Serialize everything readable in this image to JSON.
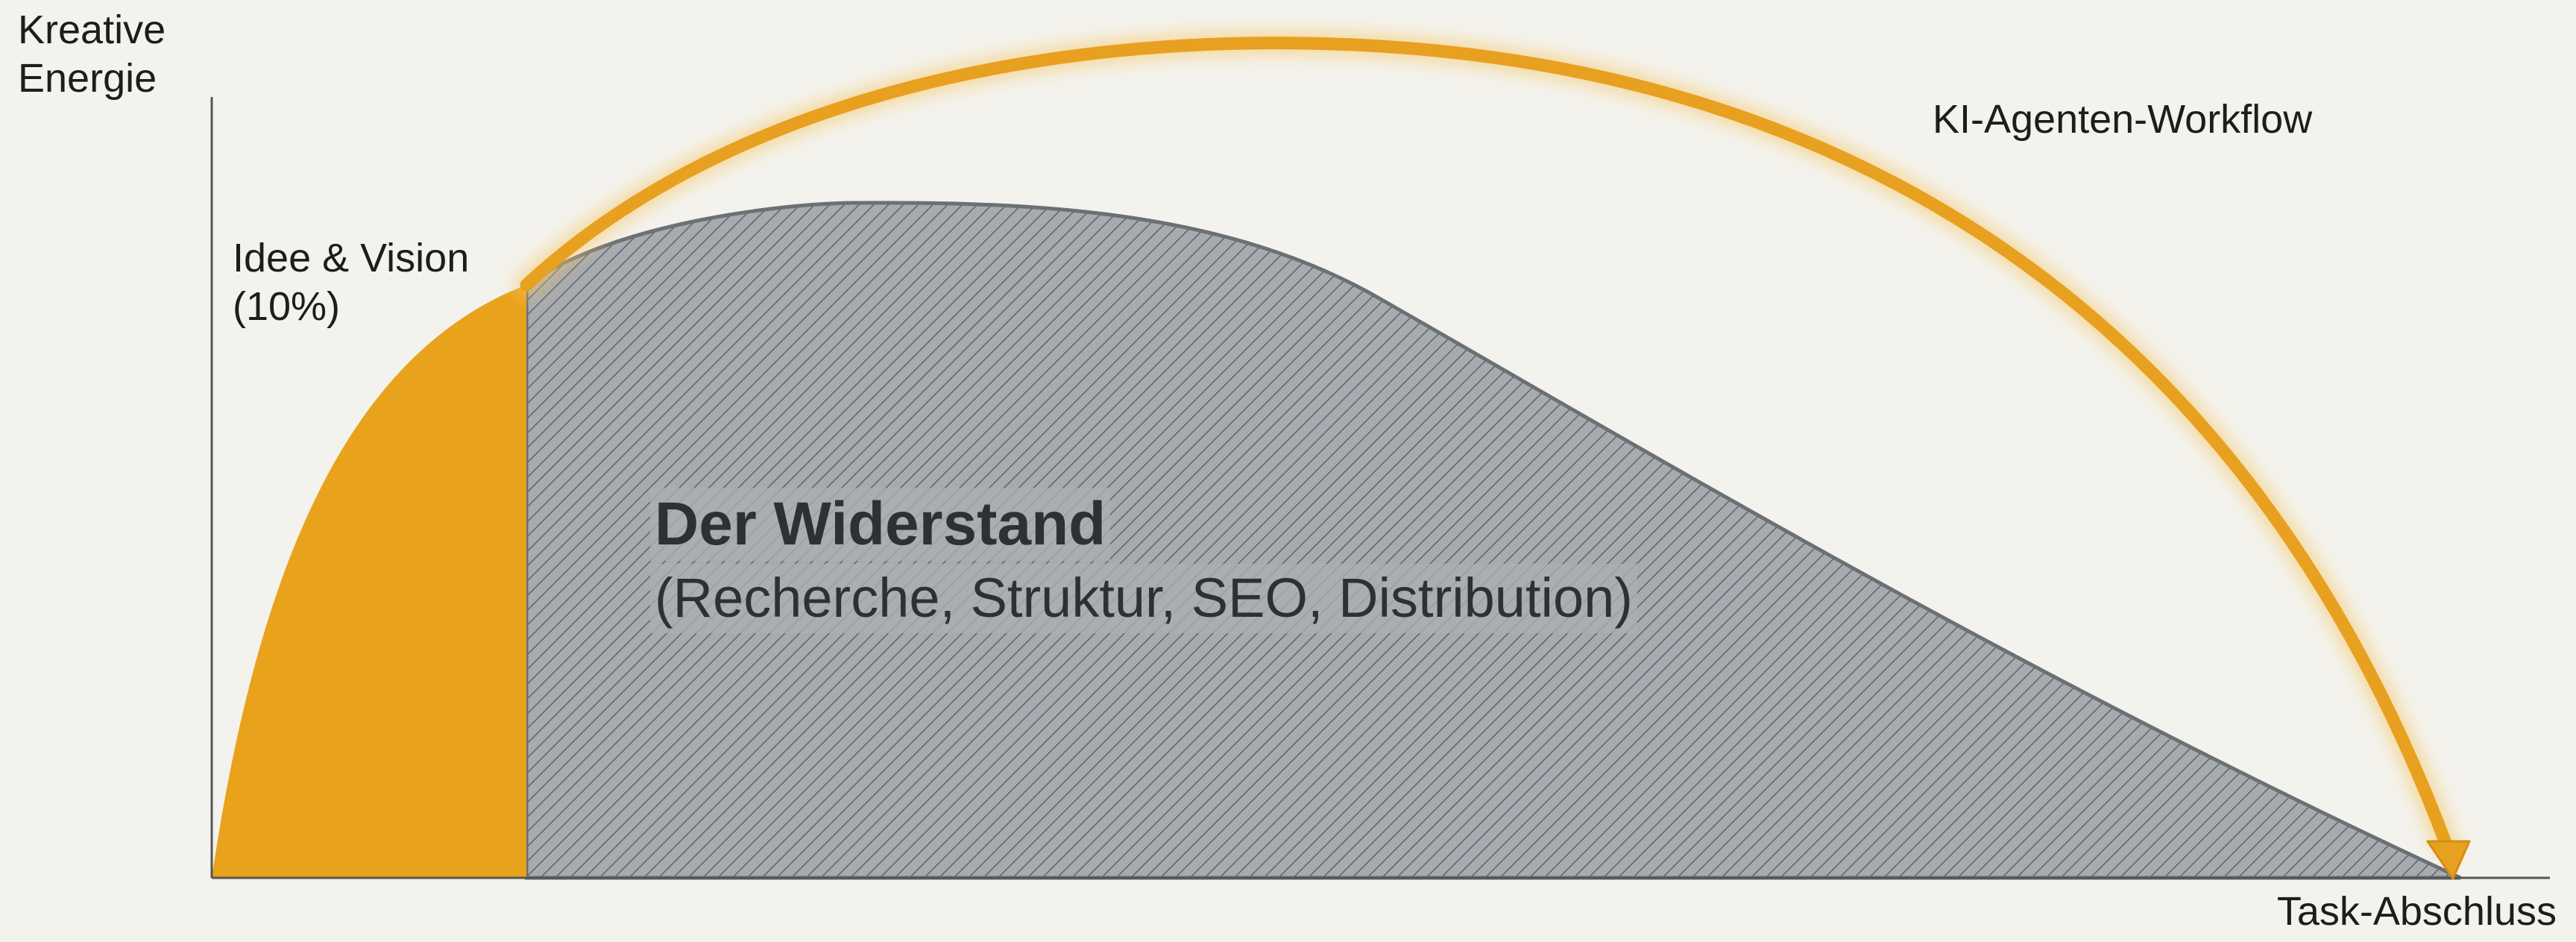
{
  "diagram": {
    "y_axis_label": "Kreative\nEnergie",
    "x_axis_label": "Task-Abschluss",
    "workflow_label": "KI-Agenten-Workflow",
    "idea_label": "Idee & Vision\n(10%)",
    "widerstand_title": "Der Widerstand",
    "widerstand_subtitle": "(Recherche, Struktur, SEO, Distribution)"
  },
  "colors": {
    "background": "#f3f2ec",
    "accent_orange": "#e9a21c",
    "resistance_gray": "#9ea2a7",
    "axis": "#555555"
  }
}
